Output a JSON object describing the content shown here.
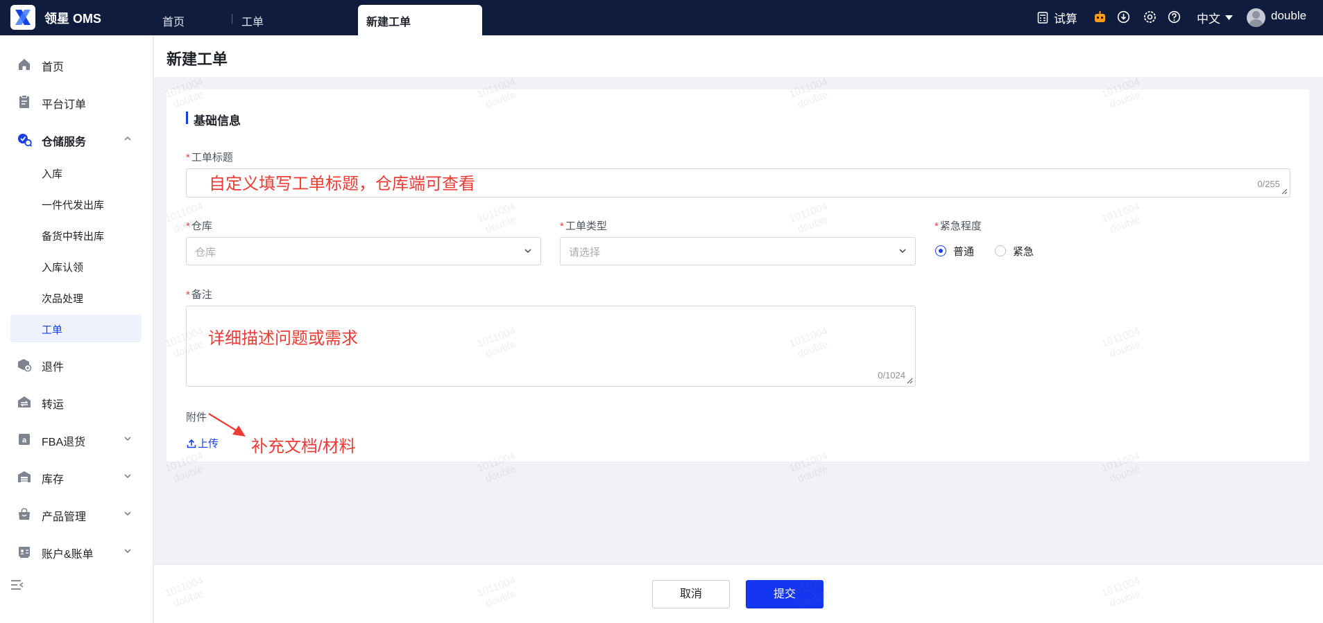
{
  "topbar": {
    "app_name": "领星 OMS",
    "tabs": [
      {
        "label": "首页"
      },
      {
        "label": "工单"
      },
      {
        "label": "新建工单",
        "active": true
      }
    ],
    "tools": {
      "calc_label": "试算",
      "robot_icon": "robot-icon",
      "download_icon": "download-icon",
      "settings_icon": "settings-icon",
      "help_icon": "help-icon",
      "language": "中文",
      "username": "double"
    },
    "colors": {
      "background": "#101c3d",
      "accent": "#1640e6"
    }
  },
  "sidebar": {
    "items": [
      {
        "label": "首页",
        "icon": "home-icon"
      },
      {
        "label": "平台订单",
        "icon": "clipboard-icon"
      },
      {
        "label": "仓储服务",
        "icon": "warehouse-service-icon",
        "expanded": true,
        "children": [
          {
            "label": "入库"
          },
          {
            "label": "一件代发出库"
          },
          {
            "label": "备货中转出库"
          },
          {
            "label": "入库认领"
          },
          {
            "label": "次品处理"
          },
          {
            "label": "工单",
            "active": true
          }
        ]
      },
      {
        "label": "退件",
        "icon": "return-box-icon"
      },
      {
        "label": "转运",
        "icon": "transfer-icon"
      },
      {
        "label": "FBA退货",
        "icon": "fba-icon"
      },
      {
        "label": "库存",
        "icon": "warehouse-icon"
      },
      {
        "label": "产品管理",
        "icon": "bag-icon"
      },
      {
        "label": "账户&账单",
        "icon": "account-icon"
      }
    ]
  },
  "page": {
    "title": "新建工单",
    "section_title": "基础信息",
    "fields": {
      "title": {
        "label": "工单标题",
        "required": true,
        "counter": "0/255"
      },
      "warehouse": {
        "label": "仓库",
        "required": true,
        "placeholder": "仓库"
      },
      "type": {
        "label": "工单类型",
        "required": true,
        "placeholder": "请选择"
      },
      "urgency": {
        "label": "紧急程度",
        "required": true,
        "options": [
          {
            "label": "普通",
            "checked": true
          },
          {
            "label": "紧急",
            "checked": false
          }
        ]
      },
      "remark": {
        "label": "备注",
        "required": true,
        "counter": "0/1024"
      },
      "attachment": {
        "label": "附件",
        "upload_label": "上传"
      }
    },
    "annotations": {
      "title_hint": "自定义填写工单标题，仓库端可查看",
      "remark_hint": "详细描述问题或需求",
      "attachment_hint": "补充文档/材料"
    }
  },
  "footer": {
    "cancel_label": "取消",
    "submit_label": "提交"
  },
  "watermark": {
    "line1": "1011004",
    "line2": "double"
  }
}
